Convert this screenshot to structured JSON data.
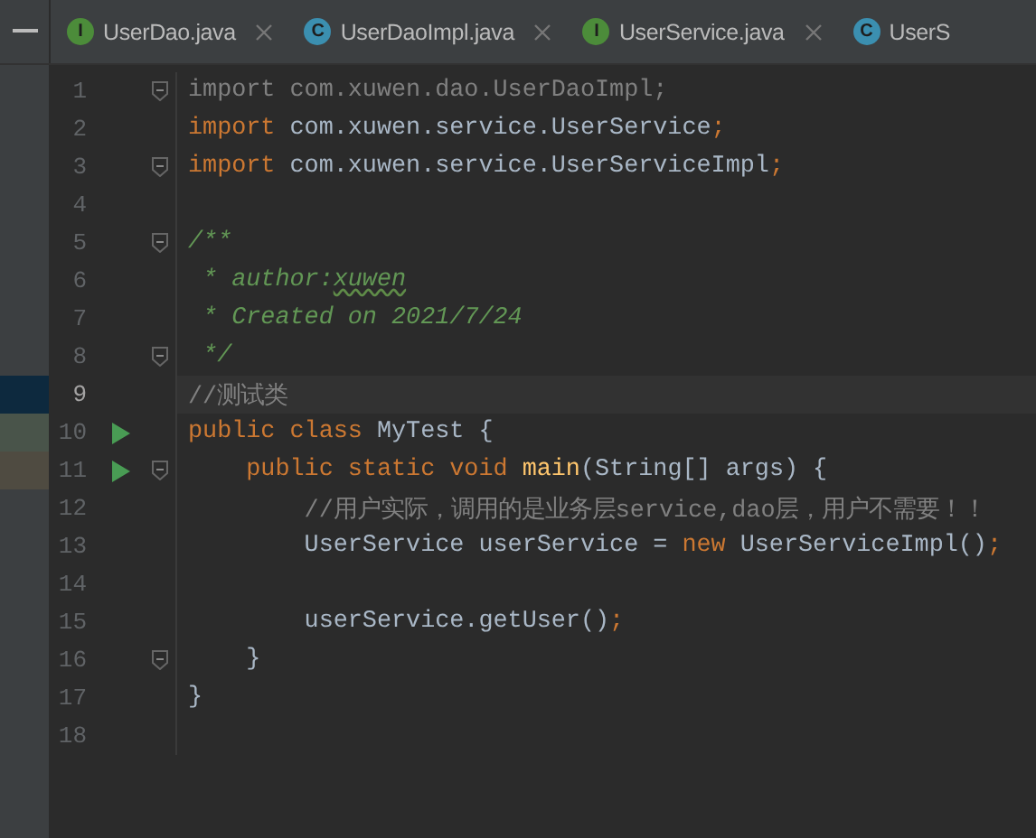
{
  "tabs": [
    {
      "label": "UserDao.java",
      "kind": "interface",
      "icon_letter": "I",
      "closable": true
    },
    {
      "label": "UserDaoImpl.java",
      "kind": "class",
      "icon_letter": "C",
      "closable": true
    },
    {
      "label": "UserService.java",
      "kind": "interface",
      "icon_letter": "I",
      "closable": true
    },
    {
      "label": "UserS",
      "kind": "class",
      "icon_letter": "C"
    }
  ],
  "lines": [
    {
      "number": "1",
      "fold": true,
      "run": false,
      "current": false,
      "tokens": [
        {
          "text": "import com.xuwen.dao.UserDaoImpl;",
          "kind": "unused"
        }
      ]
    },
    {
      "number": "2",
      "fold": false,
      "run": false,
      "current": false,
      "tokens": [
        {
          "text": "import",
          "kind": "keyword"
        },
        {
          "text": " com.xuwen.service.UserService",
          "kind": "plain"
        },
        {
          "text": ";",
          "kind": "keyword"
        }
      ]
    },
    {
      "number": "3",
      "fold": true,
      "run": false,
      "current": false,
      "tokens": [
        {
          "text": "import",
          "kind": "keyword"
        },
        {
          "text": " com.xuwen.service.UserServiceImpl",
          "kind": "plain"
        },
        {
          "text": ";",
          "kind": "keyword"
        }
      ]
    },
    {
      "number": "4",
      "fold": false,
      "run": false,
      "current": false
    },
    {
      "number": "5",
      "fold": true,
      "run": false,
      "current": false,
      "tokens": [
        {
          "text": "/**",
          "kind": "doc"
        }
      ]
    },
    {
      "number": "6",
      "fold": false,
      "run": false,
      "current": false,
      "tokens": [
        {
          "text": " * author:",
          "kind": "doc"
        },
        {
          "text": "xuwen",
          "kind": "typo"
        }
      ]
    },
    {
      "number": "7",
      "fold": false,
      "run": false,
      "current": false,
      "tokens": [
        {
          "text": " * Created on 2021/7/24",
          "kind": "doc"
        }
      ]
    },
    {
      "number": "8",
      "fold": true,
      "run": false,
      "current": false,
      "tokens": [
        {
          "text": " */",
          "kind": "doc"
        }
      ]
    },
    {
      "number": "9",
      "fold": false,
      "run": false,
      "current": true,
      "color": "#0d293e",
      "tokens": [
        {
          "text": "//测试类",
          "kind": "comment"
        }
      ]
    },
    {
      "number": "10",
      "fold": false,
      "run": true,
      "current": false,
      "color": "#49544a",
      "tokens": [
        {
          "text": "public class",
          "kind": "keyword"
        },
        {
          "text": " MyTest {",
          "kind": "plain"
        }
      ]
    },
    {
      "number": "11",
      "fold": true,
      "run": true,
      "current": false,
      "color": "#4f4b41",
      "tokens": [
        {
          "text": "    public static void ",
          "kind": "keyword"
        },
        {
          "text": "main",
          "kind": "method"
        },
        {
          "text": "(String[] args) {",
          "kind": "plain"
        }
      ]
    },
    {
      "number": "12",
      "fold": false,
      "run": false,
      "current": false,
      "tokens": [
        {
          "text": "        //用户实际，调用的是业务层service,dao层，用户不需要！！",
          "kind": "comment"
        }
      ]
    },
    {
      "number": "13",
      "fold": false,
      "run": false,
      "current": false,
      "tokens": [
        {
          "text": "        UserService userService = ",
          "kind": "plain"
        },
        {
          "text": "new",
          "kind": "keyword"
        },
        {
          "text": " UserServiceImpl()",
          "kind": "plain"
        },
        {
          "text": ";",
          "kind": "keyword"
        }
      ]
    },
    {
      "number": "14",
      "fold": false,
      "run": false,
      "current": false
    },
    {
      "number": "15",
      "fold": false,
      "run": false,
      "current": false,
      "tokens": [
        {
          "text": "        userService.getUser()",
          "kind": "plain"
        },
        {
          "text": ";",
          "kind": "keyword"
        }
      ]
    },
    {
      "number": "16",
      "fold": true,
      "run": false,
      "current": false,
      "tokens": [
        {
          "text": "    }",
          "kind": "plain"
        }
      ]
    },
    {
      "number": "17",
      "fold": false,
      "run": false,
      "current": false,
      "tokens": [
        {
          "text": "}",
          "kind": "plain"
        }
      ]
    },
    {
      "number": "18",
      "fold": false,
      "run": false,
      "current": false
    }
  ]
}
